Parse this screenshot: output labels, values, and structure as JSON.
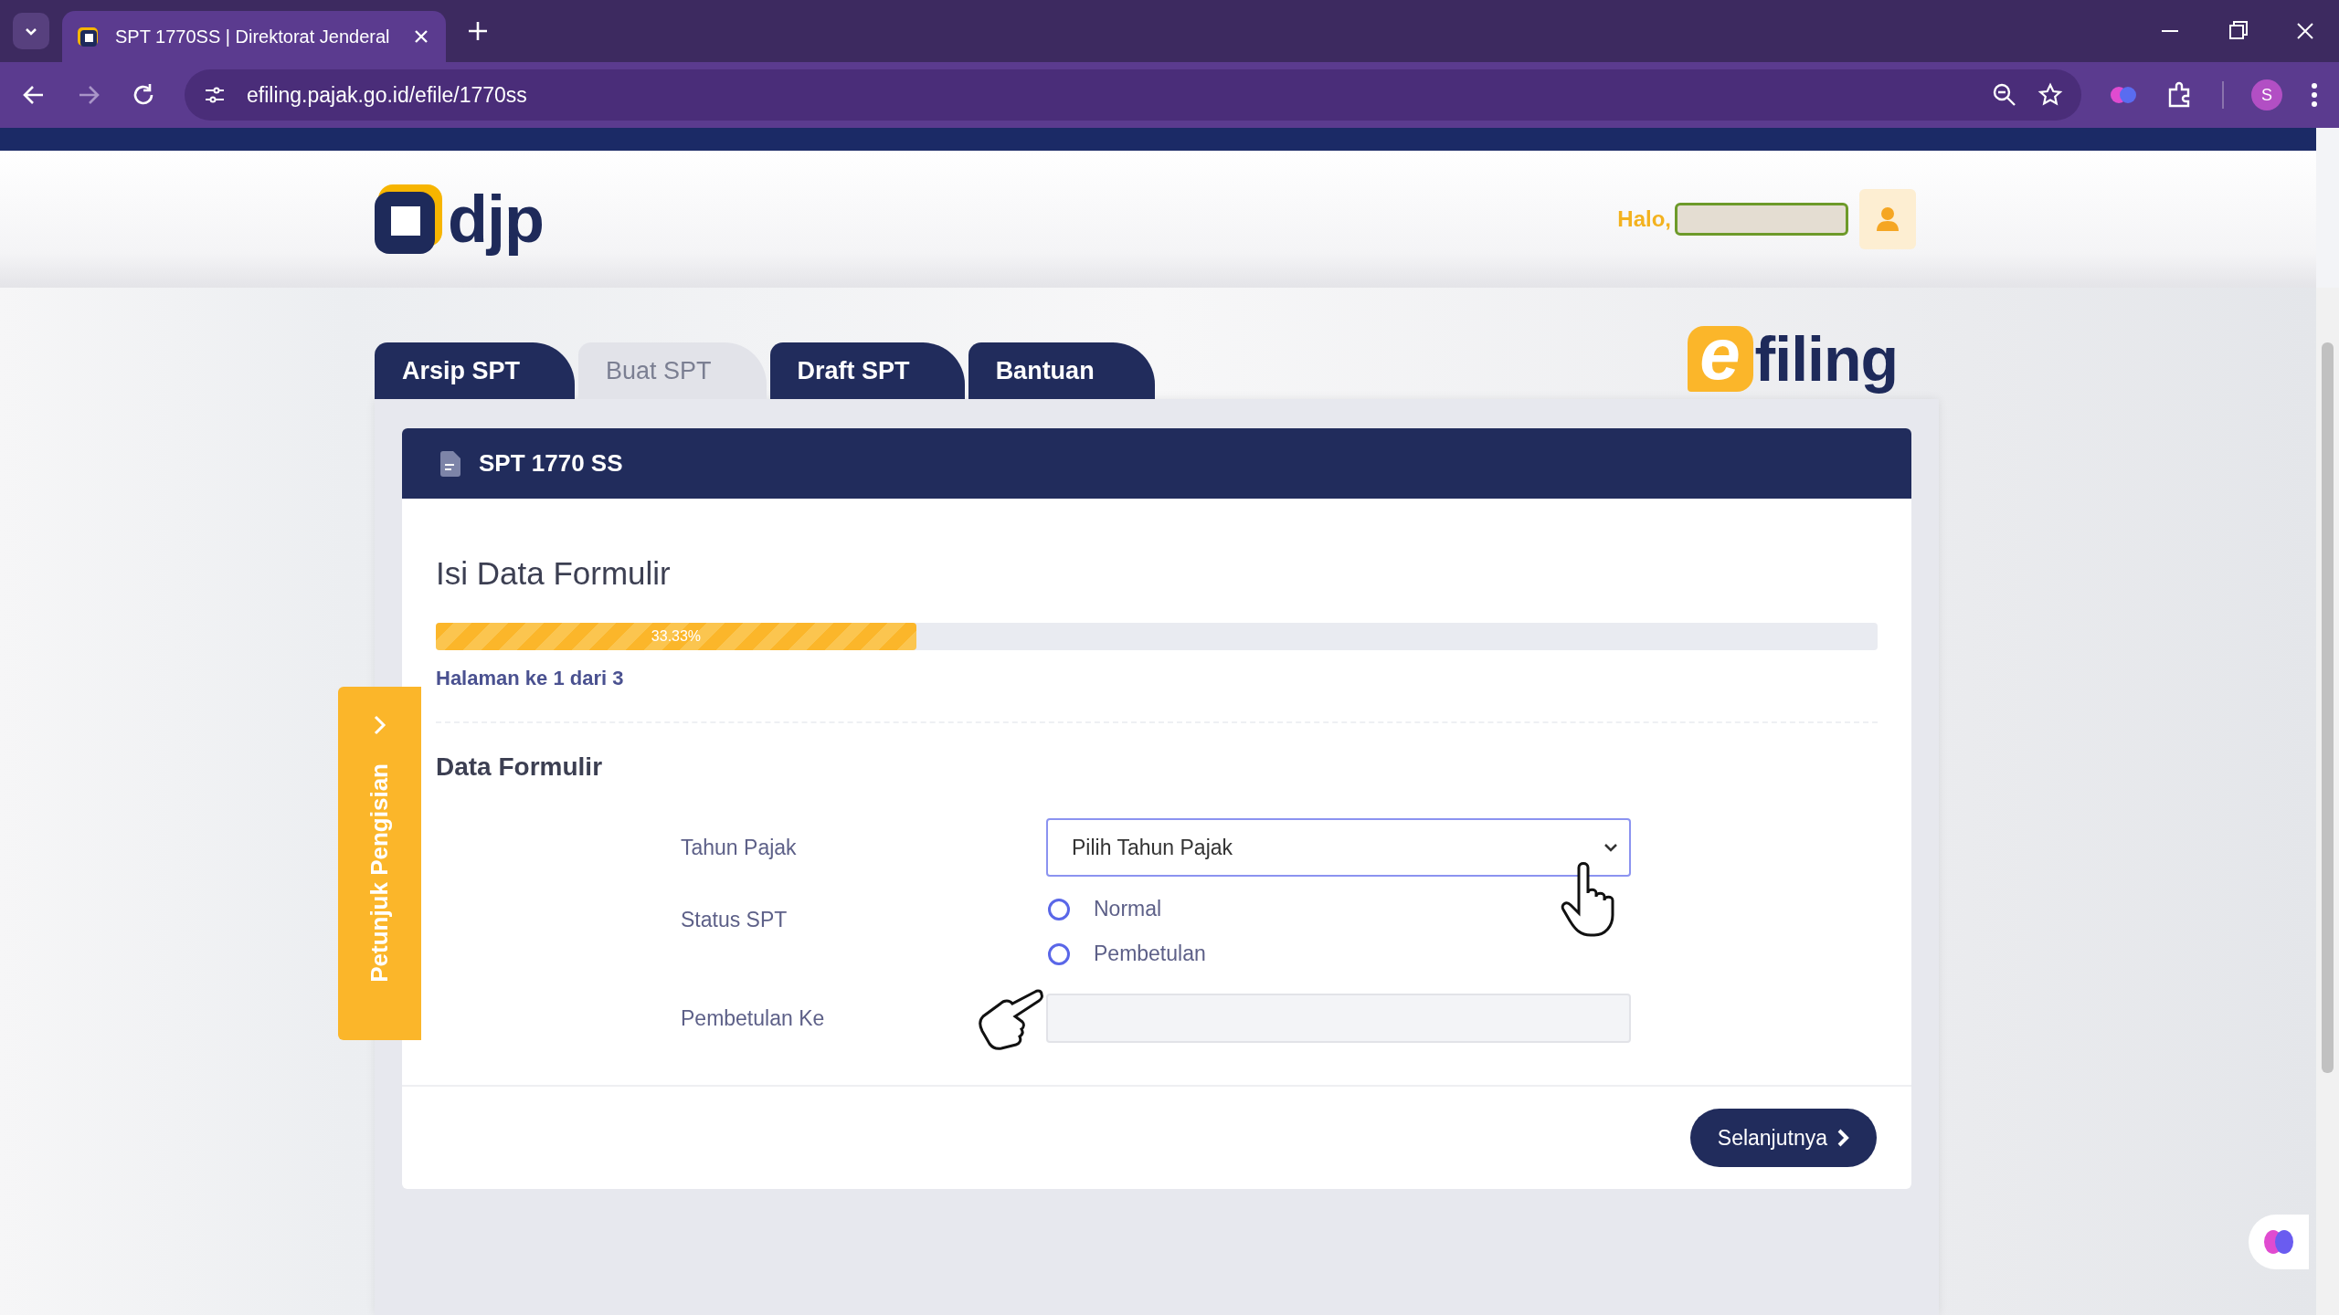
{
  "browser": {
    "tab_title": "SPT 1770SS | Direktorat Jenderal",
    "url": "efiling.pajak.go.id/efile/1770ss",
    "profile_initial": "S"
  },
  "header": {
    "logo_text": "djp",
    "greeting": "Halo,"
  },
  "nav_tabs": [
    {
      "label": "Arsip SPT",
      "selected": false
    },
    {
      "label": "Buat SPT",
      "selected": true
    },
    {
      "label": "Draft SPT",
      "selected": false
    },
    {
      "label": "Bantuan",
      "selected": false
    }
  ],
  "brand": {
    "logo_mark": "e",
    "logo_text": "filing"
  },
  "side_guide": {
    "label": "Petunjuk Pengisian"
  },
  "card": {
    "title": "SPT 1770 SS",
    "heading": "Isi Data Formulir",
    "progress": {
      "level": 0.3333,
      "label": "33.33%"
    },
    "page_info": "Halaman ke 1 dari 3",
    "section": "Data Formulir",
    "fields": [
      {
        "kind": "select",
        "label": "Tahun Pajak",
        "value": "Pilih Tahun Pajak"
      },
      {
        "kind": "radio",
        "label": "Status SPT",
        "options": [
          {
            "label": "Normal",
            "selected": false
          },
          {
            "label": "Pembetulan",
            "selected": false
          }
        ]
      },
      {
        "kind": "text",
        "label": "Pembetulan Ke",
        "disabled": true
      }
    ],
    "next_button": "Selanjutnya"
  }
}
